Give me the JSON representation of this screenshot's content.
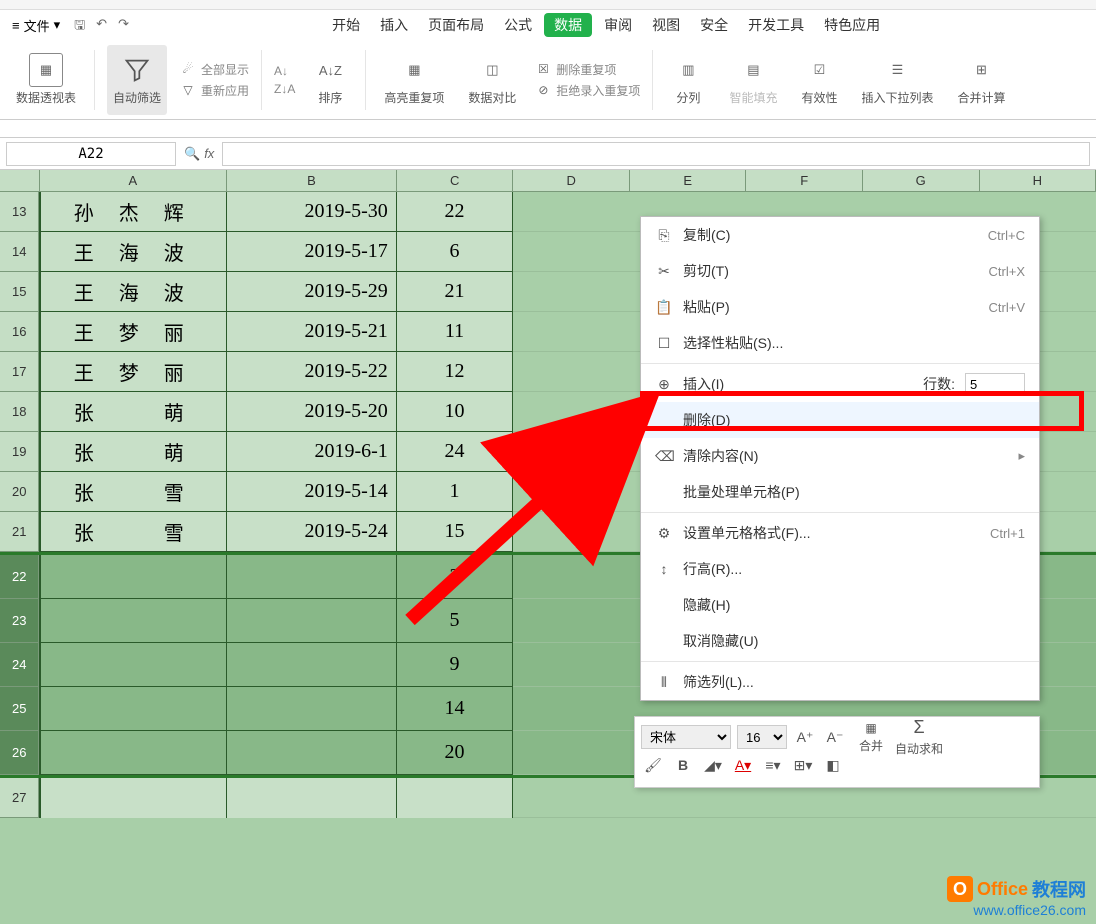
{
  "menu": {
    "file": "文件",
    "items": [
      "开始",
      "插入",
      "页面布局",
      "公式",
      "数据",
      "审阅",
      "视图",
      "安全",
      "开发工具",
      "特色应用"
    ],
    "activeIndex": 4
  },
  "ribbon": {
    "pivot": "数据透视表",
    "autofilter": "自动筛选",
    "showall": "全部显示",
    "reapply": "重新应用",
    "sort_asc": "A↓",
    "sort_desc": "Z↓A",
    "sort": "排序",
    "highlight_dup": "高亮重复项",
    "data_compare": "数据对比",
    "del_dup": "删除重复项",
    "reject_dup": "拒绝录入重复项",
    "split": "分列",
    "fill": "智能填充",
    "validation": "有效性",
    "dropdown": "插入下拉列表",
    "merge_calc": "合并计算"
  },
  "namebox": "A22",
  "fx": "fx",
  "columns": [
    "A",
    "B",
    "C",
    "D",
    "E",
    "F",
    "G",
    "H"
  ],
  "rows": [
    {
      "num": "13",
      "a": "孙 杰 辉",
      "b": "2019-5-30",
      "c": "22"
    },
    {
      "num": "14",
      "a": "王 海 波",
      "b": "2019-5-17",
      "c": "6"
    },
    {
      "num": "15",
      "a": "王 海 波",
      "b": "2019-5-29",
      "c": "21"
    },
    {
      "num": "16",
      "a": "王 梦 丽",
      "b": "2019-5-21",
      "c": "11"
    },
    {
      "num": "17",
      "a": "王 梦 丽",
      "b": "2019-5-22",
      "c": "12"
    },
    {
      "num": "18",
      "a": "张 　 萌",
      "b": "2019-5-20",
      "c": "10"
    },
    {
      "num": "19",
      "a": "张 　 萌",
      "b": "2019-6-1",
      "c": "24"
    },
    {
      "num": "20",
      "a": "张 　 雪",
      "b": "2019-5-14",
      "c": "1"
    },
    {
      "num": "21",
      "a": "张 　 雪",
      "b": "2019-5-24",
      "c": "15"
    }
  ],
  "selectedRows": [
    {
      "num": "22",
      "c": "3"
    },
    {
      "num": "23",
      "c": "5"
    },
    {
      "num": "24",
      "c": "9"
    },
    {
      "num": "25",
      "c": "14"
    },
    {
      "num": "26",
      "c": "20"
    }
  ],
  "rowAfter": {
    "num": "27"
  },
  "contextMenu": {
    "copy": "复制(C)",
    "copy_sc": "Ctrl+C",
    "cut": "剪切(T)",
    "cut_sc": "Ctrl+X",
    "paste": "粘贴(P)",
    "paste_sc": "Ctrl+V",
    "paste_special": "选择性粘贴(S)...",
    "insert": "插入(I)",
    "row_count_label": "行数:",
    "row_count_val": "5",
    "delete": "删除(D)",
    "clear": "清除内容(N)",
    "batch": "批量处理单元格(P)",
    "format": "设置单元格格式(F)...",
    "format_sc": "Ctrl+1",
    "row_height": "行高(R)...",
    "hide": "隐藏(H)",
    "unhide": "取消隐藏(U)",
    "filter_col": "筛选列(L)..."
  },
  "miniToolbar": {
    "font": "宋体",
    "size": "16",
    "merge": "合并",
    "autosum": "自动求和"
  },
  "watermark": {
    "brand1": "Office",
    "brand2": "教程网",
    "url": "www.office26.com"
  }
}
